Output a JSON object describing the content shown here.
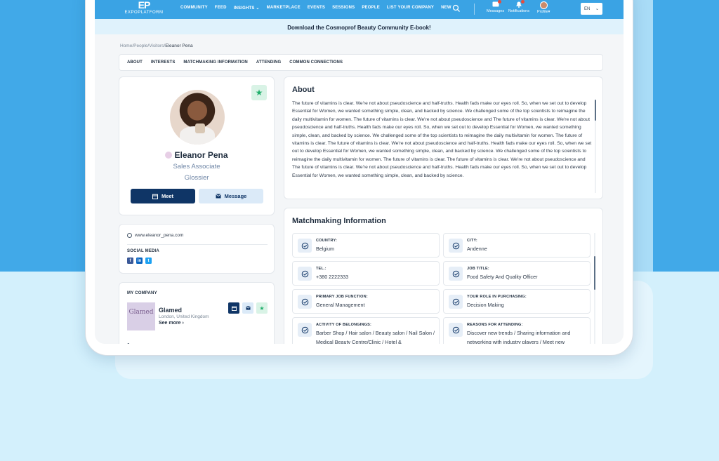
{
  "nav": {
    "logo_mark": "EP",
    "logo_text": "EXPOPLATFORM",
    "items": [
      "COMMUNITY",
      "FEED",
      "INSIGHTS",
      "MARKETPLACE",
      "EVENTS",
      "SESSIONS",
      "PEOPLE",
      "LIST YOUR COMPANY",
      "NEW"
    ],
    "messages_label": "Messages",
    "notifications_label": "Notifications",
    "profile_label": "Profile",
    "language": "EN"
  },
  "banner": {
    "text": "Download the Cosmoprof Beauty Community E-book!"
  },
  "breadcrumb": {
    "home": "Home/",
    "people": "People/",
    "visitors": "Visitors/",
    "current": "Eleanor Pena"
  },
  "tabs": [
    "ABOUT",
    "INTERESTS",
    "MATCHMAKING INFORMATION",
    "ATTENDING",
    "COMMON CONNECTIONS"
  ],
  "profile": {
    "name": "Eleanor Pena",
    "role": "Sales Associate",
    "company": "Glossier",
    "meet_label": "Meet",
    "message_label": "Message"
  },
  "contact": {
    "website": "www.eleanor_pena.com",
    "social_label": "SOCIAL MEDIA",
    "social": [
      "facebook-icon",
      "linkedin-icon",
      "twitter-icon"
    ]
  },
  "my_company": {
    "label": "MY COMPANY",
    "logo_text": "Glamed",
    "name": "Glamed",
    "location": "London, United Kingdom",
    "see_more": "See more"
  },
  "about": {
    "title": "About",
    "text": "The future of vitamins is clear. We're not about pseudoscience and half-truths. Health fads make our eyes roll. So, when we set out to develop Essential for Women, we wanted something simple, clean, and backed by science. We challenged some of the top scientists to reimagine the daily multivitamin for women. The future of vitamins is clear. We're not about pseudoscience and The future of vitamins is clear. We're not about pseudoscience and half-truths. Health fads make our eyes roll. So, when we set out to develop Essential for Women, we wanted something simple, clean, and backed by science. We challenged some of the top scientists to reimagine the daily multivitamin for women. The future of vitamins is clear. The future of vitamins is clear. We're not about pseudoscience and half-truths. Health fads make our eyes roll. So, when we set out to develop Essential for Women, we wanted something simple, clean, and backed by science. We challenged some of the top scientists to reimagine the daily multivitamin for women. The future of vitamins is clear.  The future of vitamins is clear. We're not about pseudoscience and The future of vitamins is clear. We're not about pseudoscience and half-truths. Health fads make our eyes roll. So, when we set out to develop Essential for Women, we wanted something simple, clean, and backed by science."
  },
  "matchmaking": {
    "title": "Matchmaking Information",
    "items": [
      {
        "label": "COUNTRY:",
        "value": "Belgium"
      },
      {
        "label": "CITY:",
        "value": "Andenne"
      },
      {
        "label": "TEL.:",
        "value": "+380 2222333"
      },
      {
        "label": "JOB TITLE:",
        "value": "Food Safety And Quality Officer"
      },
      {
        "label": "PRIMARY JOB FUNCTION:",
        "value": "General Management"
      },
      {
        "label": "YOUR ROLE IN PURCHASING:",
        "value": "Decision Making"
      },
      {
        "label": "ACTIVITY OF BELONGINGS:",
        "value": "Barber Shop / Hair salon / Beauty salon / Nail Salon / Medical Beauty Centre/Clinic / Hotel &"
      },
      {
        "label": "REASONS FOR ATTENDING:",
        "value": "Discover new trends / Sharing information and networking with industry players / Meet new"
      }
    ]
  },
  "colors": {
    "nav_blue": "#3aa3e4",
    "page_blue": "#41a9e8",
    "primary_navy": "#0f3566",
    "favorite_green": "#1fae6a"
  }
}
